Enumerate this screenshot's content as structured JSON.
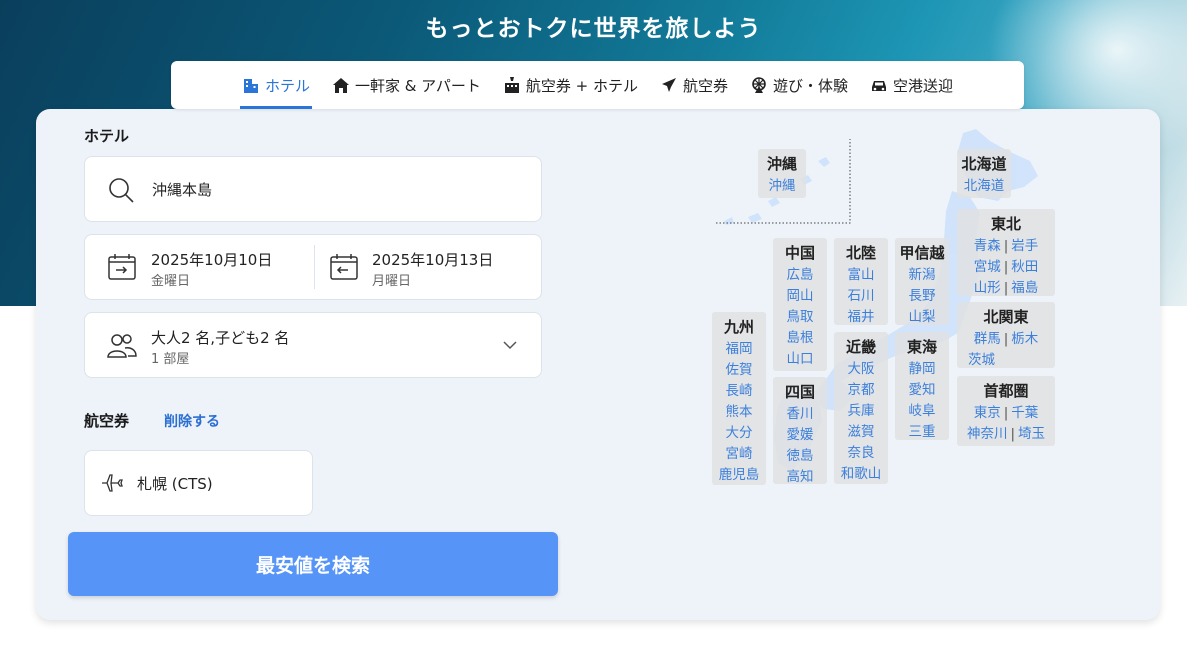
{
  "hero": {
    "title": "もっとおトクに世界を旅しよう"
  },
  "tabs": [
    {
      "label": "ホテル",
      "icon": "hotel-icon",
      "active": true
    },
    {
      "label": "一軒家 & アパート",
      "icon": "house-icon",
      "active": false
    },
    {
      "label": "航空券 + ホテル",
      "icon": "flight-hotel-icon",
      "active": false
    },
    {
      "label": "航空券",
      "icon": "airplane-icon",
      "active": false
    },
    {
      "label": "遊び・体験",
      "icon": "ferris-wheel-icon",
      "active": false
    },
    {
      "label": "空港送迎",
      "icon": "car-icon",
      "active": false
    }
  ],
  "hotel": {
    "section_label": "ホテル",
    "destination": "沖縄本島",
    "checkin": {
      "date": "2025年10月10日",
      "weekday": "金曜日"
    },
    "checkout": {
      "date": "2025年10月13日",
      "weekday": "月曜日"
    },
    "guests": {
      "summary": "大人2 名,子ども2 名",
      "rooms": "1 部屋"
    }
  },
  "flight": {
    "section_label": "航空券",
    "remove_label": "削除する",
    "origin": "札幌 (CTS)"
  },
  "search_button": "最安値を検索",
  "colors": {
    "accent": "#2b74d8",
    "button": "#5794f7",
    "link": "#3b7fdc"
  },
  "map": {
    "okinawa": {
      "name": "沖縄",
      "prefs": [
        "沖縄"
      ]
    },
    "hokkaido": {
      "name": "北海道",
      "prefs": [
        "北海道"
      ]
    },
    "tohoku": {
      "name": "東北",
      "rows": [
        [
          "青森",
          "岩手"
        ],
        [
          "宮城",
          "秋田"
        ],
        [
          "山形",
          "福島"
        ]
      ]
    },
    "kitakanto": {
      "name": "北関東",
      "rows": [
        [
          "群馬",
          "栃木"
        ],
        [
          "茨城"
        ]
      ]
    },
    "shutoken": {
      "name": "首都圏",
      "rows": [
        [
          "東京",
          "千葉"
        ],
        [
          "神奈川",
          "埼玉"
        ]
      ]
    },
    "chugoku": {
      "name": "中国",
      "prefs": [
        "広島",
        "岡山",
        "鳥取",
        "島根",
        "山口"
      ]
    },
    "hokuriku": {
      "name": "北陸",
      "prefs": [
        "富山",
        "石川",
        "福井"
      ]
    },
    "koshinetsu": {
      "name": "甲信越",
      "prefs": [
        "新潟",
        "長野",
        "山梨"
      ]
    },
    "kyushu": {
      "name": "九州",
      "prefs": [
        "福岡",
        "佐賀",
        "長崎",
        "熊本",
        "大分",
        "宮崎",
        "鹿児島"
      ]
    },
    "kinki": {
      "name": "近畿",
      "prefs": [
        "大阪",
        "京都",
        "兵庫",
        "滋賀",
        "奈良",
        "和歌山"
      ]
    },
    "tokai": {
      "name": "東海",
      "prefs": [
        "静岡",
        "愛知",
        "岐阜",
        "三重"
      ]
    },
    "shikoku": {
      "name": "四国",
      "prefs": [
        "香川",
        "愛媛",
        "徳島",
        "高知"
      ]
    }
  }
}
